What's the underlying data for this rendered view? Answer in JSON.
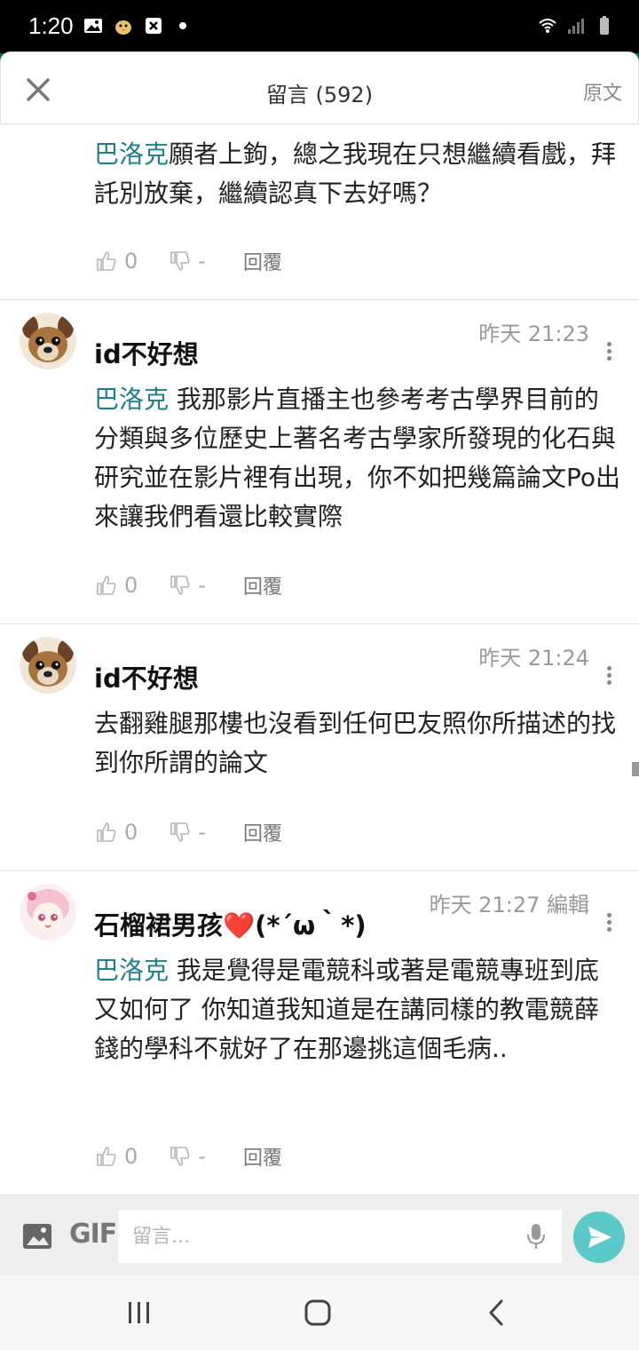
{
  "status_bar": {
    "time": "1:20"
  },
  "header": {
    "title": "留言 (592)",
    "original_link": "原文"
  },
  "comments": [
    {
      "mention": "巴洛克",
      "text": "願者上鉤，總之我現在只想繼續看戲，拜託別放棄，繼續認真下去好嗎？",
      "likes": "0",
      "dislikes": "-",
      "reply_label": "回覆"
    },
    {
      "username": "id不好想",
      "timestamp": "昨天 21:23",
      "mention": "巴洛克",
      "text": " 我那影片直播主也參考考古學界目前的分類與多位歷史上著名考古學家所發現的化石與研究並在影片裡有出現，你不如把幾篇論文Po出來讓我們看還比較實際",
      "likes": "0",
      "dislikes": "-",
      "reply_label": "回覆"
    },
    {
      "username": "id不好想",
      "timestamp": "昨天 21:24",
      "text": "去翻雞腿那樓也沒看到任何巴友照你所描述的找到你所謂的論文",
      "likes": "0",
      "dislikes": "-",
      "reply_label": "回覆"
    },
    {
      "username": "石榴裙男孩❤️(*´ω｀*)",
      "timestamp": "昨天 21:27 編輯",
      "mention": "巴洛克",
      "text": " 我是覺得是電競科或著是電競專班到底又如何了 你知道我知道是在講同樣的教電競薛錢的學科不就好了在那邊挑這個毛病..",
      "likes": "0",
      "dislikes": "-",
      "reply_label": "回覆"
    }
  ],
  "input_bar": {
    "gif_label": "GIF",
    "placeholder": "留言..."
  },
  "colors": {
    "accent": "#1b7f8c",
    "send_button": "#5cc9c9",
    "header_band": "#0d6b6b"
  }
}
